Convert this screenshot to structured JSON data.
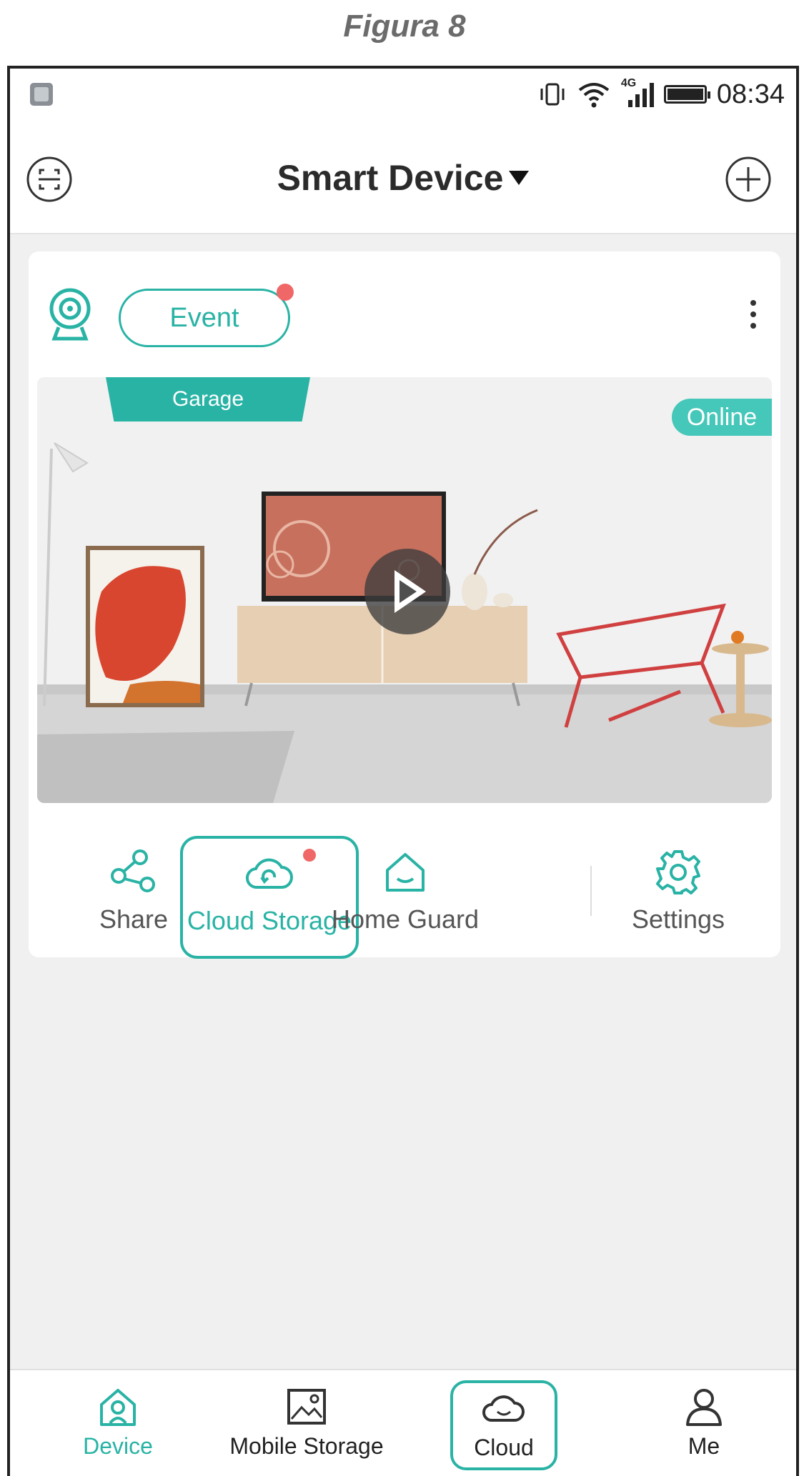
{
  "figure_caption": "Figura 8",
  "status_bar": {
    "time": "08:34",
    "network": "4G"
  },
  "header": {
    "title": "Smart Device"
  },
  "device_card": {
    "event_label": "Event",
    "camera_name": "Garage",
    "status": "Online",
    "actions": [
      {
        "label": "Share",
        "icon": "share-icon"
      },
      {
        "label": "Cloud Storage",
        "icon": "cloud-icon"
      },
      {
        "label": "Home Guard",
        "icon": "home-icon"
      },
      {
        "label": "Settings",
        "icon": "gear-icon"
      }
    ]
  },
  "bottom_nav": {
    "items": [
      {
        "label": "Device",
        "icon": "device-home-icon"
      },
      {
        "label": "Mobile Storage",
        "icon": "image-icon"
      },
      {
        "label": "Cloud",
        "icon": "cloud-icon"
      },
      {
        "label": "Me",
        "icon": "person-icon"
      }
    ]
  },
  "colors": {
    "accent": "#29b3a5",
    "notification_dot": "#f06767",
    "background": "#f0f0f0"
  }
}
